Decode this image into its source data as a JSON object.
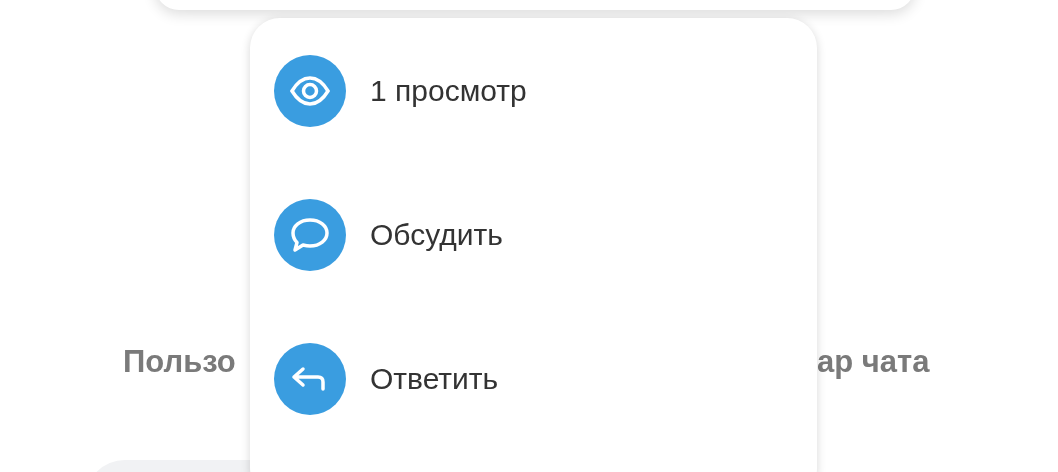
{
  "background": {
    "caption_left": "Пользо",
    "caption_right": "ар чата"
  },
  "menu": {
    "items": [
      {
        "kind": "views",
        "label": "1 просмотр"
      },
      {
        "kind": "discuss",
        "label": "Обсудить"
      },
      {
        "kind": "reply",
        "label": "Ответить"
      }
    ]
  }
}
